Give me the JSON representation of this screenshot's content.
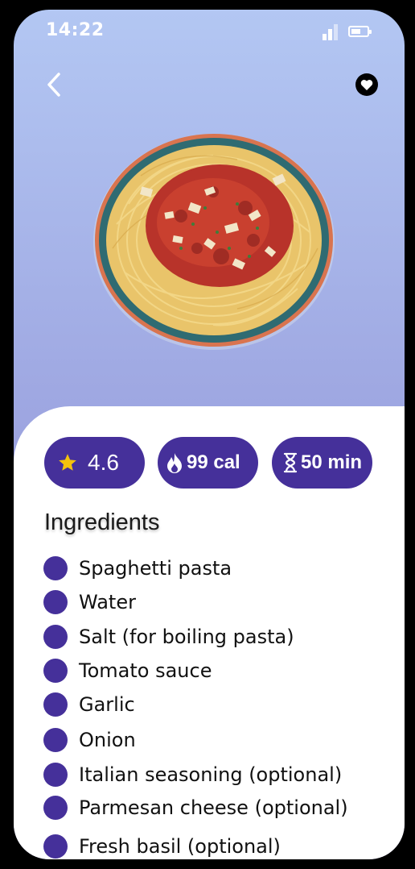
{
  "status_bar": {
    "time": "14:22"
  },
  "header": {
    "back_icon": "chevron-left-icon",
    "favorite_icon": "heart-icon"
  },
  "stats": {
    "rating": "4.6",
    "calories": "99 cal",
    "duration": "50 min"
  },
  "ingredients": {
    "title": "Ingredients",
    "items": [
      "Spaghetti pasta",
      "Water",
      "Salt (for boiling pasta)",
      "Tomato sauce",
      "Garlic",
      "Onion",
      "Italian seasoning (optional)",
      "Parmesan cheese (optional)",
      "Fresh basil (optional)"
    ]
  },
  "colors": {
    "accent": "#45309a",
    "star": "#f4c20d",
    "gradient_top": "#b3c7f3",
    "gradient_bottom": "#8882d0"
  }
}
